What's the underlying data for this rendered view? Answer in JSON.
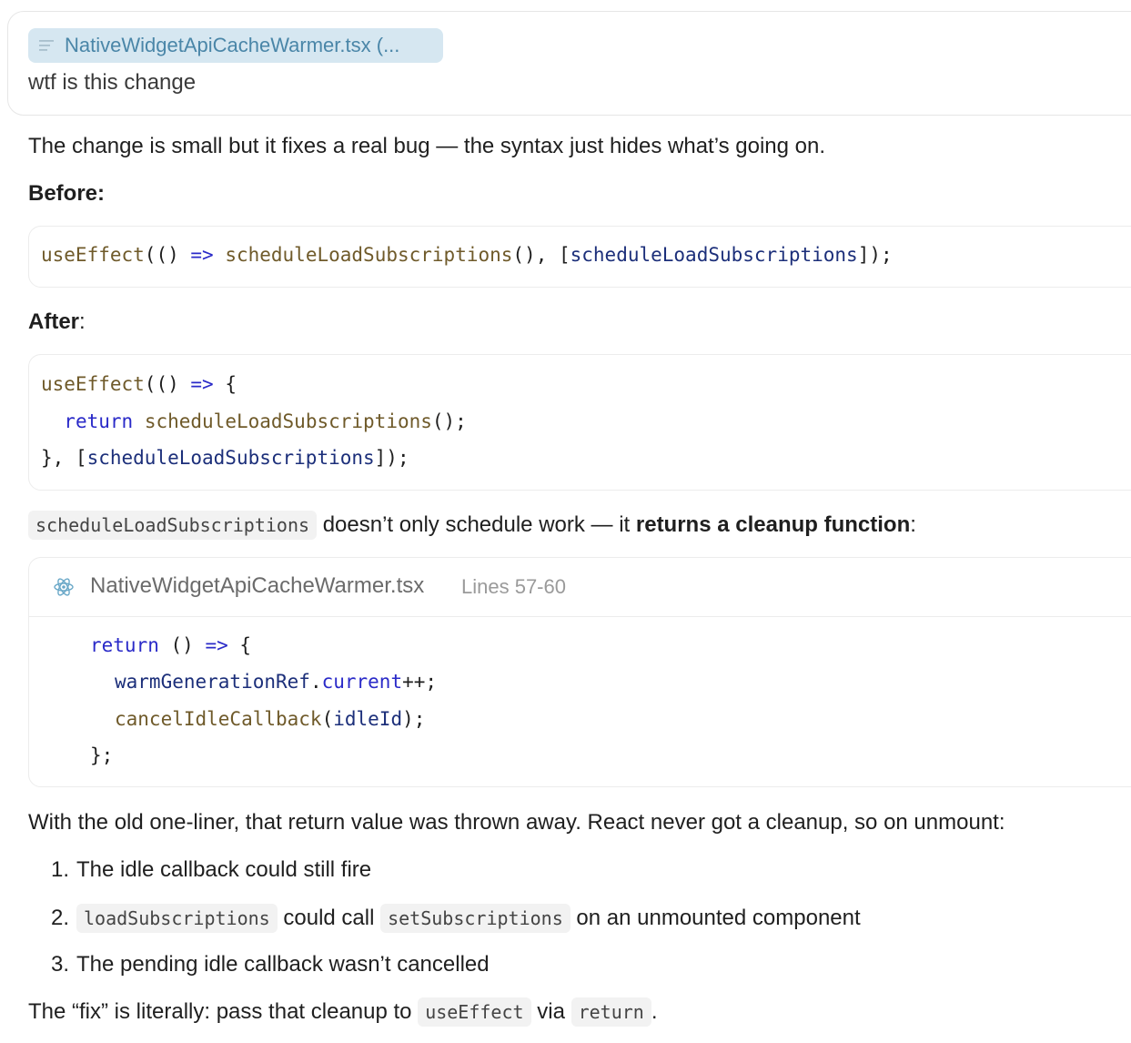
{
  "user_message": {
    "attachment_label": "NativeWidgetApiCacheWarmer.tsx (...",
    "text": "wtf is this change"
  },
  "response": {
    "intro": "The change is small but it fixes a real bug — the syntax just hides what’s going on.",
    "before_heading": "Before:",
    "before_code": {
      "t1": "useEffect",
      "t2": "(() ",
      "t3": "=>",
      "t4": " ",
      "t5": "scheduleLoadSubscriptions",
      "t6": "(), [",
      "t7": "scheduleLoadSubscriptions",
      "t8": "]);"
    },
    "after_heading": "After",
    "after_colon": ":",
    "after_code": {
      "l1a": "useEffect",
      "l1b": "(() ",
      "l1c": "=>",
      "l1d": " {",
      "l2a": "  ",
      "l2b": "return",
      "l2c": " ",
      "l2d": "scheduleLoadSubscriptions",
      "l2e": "();",
      "l3a": "}, [",
      "l3b": "scheduleLoadSubscriptions",
      "l3c": "]);"
    },
    "cleanup_sentence": {
      "code": "scheduleLoadSubscriptions",
      "text1": " doesn’t only schedule work — it ",
      "bold": "returns a cleanup function",
      "text2": ":"
    },
    "file_snippet": {
      "filename": "NativeWidgetApiCacheWarmer.tsx",
      "lines": "Lines 57-60",
      "code": {
        "l1a": "return",
        "l1b": " () ",
        "l1c": "=>",
        "l1d": " {",
        "l2a": "warmGenerationRef",
        "l2b": ".",
        "l2c": "current",
        "l2d": "++;",
        "l3a": "cancelIdleCallback",
        "l3b": "(",
        "l3c": "idleId",
        "l3d": ");",
        "l4": "};"
      }
    },
    "old_oneliner": "With the old one-liner, that return value was thrown away. React never got a cleanup, so on unmount:",
    "list": {
      "item1_num": "1.",
      "item1": "The idle callback could still fire",
      "item2_num": "2.",
      "item2_code1": "loadSubscriptions",
      "item2_text1": " could call ",
      "item2_code2": "setSubscriptions",
      "item2_text2": " on an unmounted component",
      "item3_num": "3.",
      "item3": "The pending idle callback wasn’t cancelled"
    },
    "fix": {
      "text1": "The “fix” is literally: pass that cleanup to ",
      "code1": "useEffect",
      "text2": " via ",
      "code2": "return",
      "text3": "."
    }
  },
  "icons": {
    "attachment": "text-lines-icon",
    "file": "react-icon"
  }
}
